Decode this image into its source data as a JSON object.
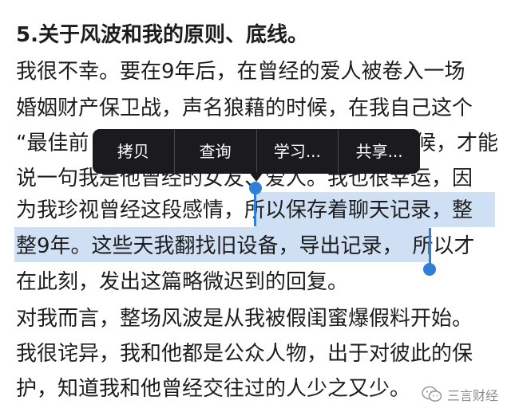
{
  "article": {
    "line1": "5.关于风波和我的原则、底线。",
    "line2": "我很不幸。要在9年后，在曾经的爱人被卷入一场",
    "line3": "婚姻财产保卫战，声名狼藉的时候，在我自己这个",
    "line4_a": "“最佳前",
    "line4_b": "候，才能",
    "line5": "说一句我是他曾经的女友、爱人。我也很幸运，因",
    "line6_pre": "为我珍视曾经这段感情，",
    "line6_sel": "所以保存着聊天记录，整",
    "line7_sel": "整9年。这些天我翻找旧设备，导出记录，",
    "line7_post": "所以才",
    "line8": "在此刻，发出这篇略微迟到的回复。",
    "line9": "对我而言，整场风波是从我被假闺蜜爆假料开始。",
    "line10": "我很诧异，我和他都是公众人物，出于对彼此的保",
    "line11": "护，知道我和他曾经交往过的人少之又少。"
  },
  "context_menu": {
    "copy": "拷贝",
    "lookup": "查询",
    "learn": "学习...",
    "share": "共享..."
  },
  "watermark": {
    "text": "三言财经",
    "icon": "wechat-icon"
  },
  "colors": {
    "selection": "#cfe0f4",
    "handle": "#2f7ed8",
    "menu_bg": "#1b1b1d"
  }
}
